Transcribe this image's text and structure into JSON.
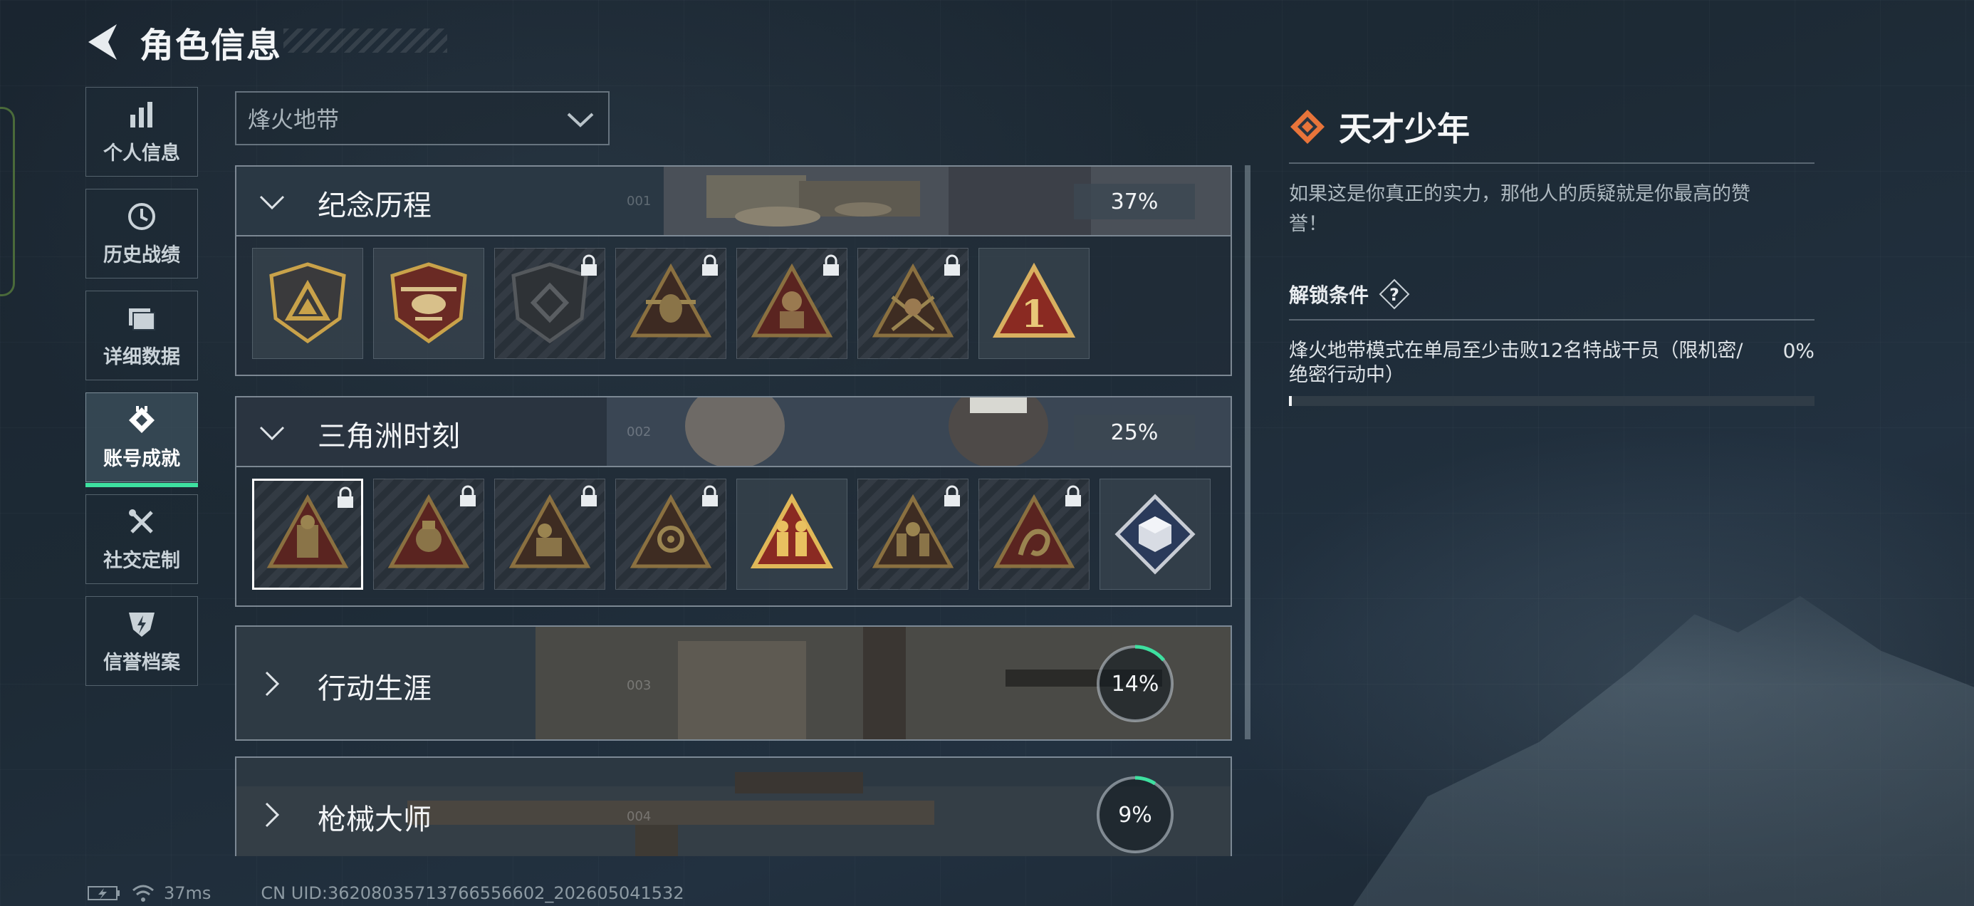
{
  "header": {
    "title": "角色信息"
  },
  "sidebar": {
    "items": [
      {
        "label": "个人信息",
        "icon": "bar-chart-icon"
      },
      {
        "label": "历史战绩",
        "icon": "history-clock-icon"
      },
      {
        "label": "详细数据",
        "icon": "folder-icon"
      },
      {
        "label": "账号成就",
        "icon": "achievement-badge-icon",
        "active": true
      },
      {
        "label": "社交定制",
        "icon": "tools-icon"
      },
      {
        "label": "信誉档案",
        "icon": "lightning-shield-icon"
      }
    ]
  },
  "filter": {
    "selected": "烽火地带"
  },
  "categories": [
    {
      "name": "纪念历程",
      "number": "001",
      "progress": "37%",
      "expanded": true,
      "badges": [
        {
          "icon": "shield-triangle-badge-icon",
          "locked": false
        },
        {
          "icon": "helicopter-badge-icon",
          "locked": false
        },
        {
          "icon": "emblem-badge-icon",
          "locked": true
        },
        {
          "icon": "plane-badge-icon",
          "locked": true
        },
        {
          "icon": "soldier-badge-icon",
          "locked": true
        },
        {
          "icon": "crossed-swords-badge-icon",
          "locked": true
        },
        {
          "icon": "number-one-badge-icon",
          "locked": false,
          "text": "1"
        }
      ]
    },
    {
      "name": "三角洲时刻",
      "number": "002",
      "progress": "25%",
      "expanded": true,
      "badges": [
        {
          "icon": "operator-badge-icon",
          "locked": true,
          "selected": true
        },
        {
          "icon": "medal-badge-icon",
          "locked": true
        },
        {
          "icon": "squad-badge-icon",
          "locked": true
        },
        {
          "icon": "tactical-badge-icon",
          "locked": true
        },
        {
          "icon": "gold-team-badge-icon",
          "locked": false
        },
        {
          "icon": "team-badge-icon",
          "locked": true
        },
        {
          "icon": "dragon-badge-icon",
          "locked": true
        },
        {
          "icon": "cube-badge-icon",
          "locked": false
        }
      ]
    },
    {
      "name": "行动生涯",
      "number": "003",
      "progress": "14%",
      "progress_value": 14,
      "expanded": false
    },
    {
      "name": "枪械大师",
      "number": "004",
      "progress": "9%",
      "progress_value": 9,
      "expanded": false
    }
  ],
  "detail": {
    "title": "天才少年",
    "description": "如果这是你真正的实力，那他人的质疑就是你最高的赞誉！",
    "condition_header": "解锁条件",
    "condition_text": "烽火地带模式在单局至少击败12名特战干员（限机密/绝密行动中）",
    "condition_progress": "0%",
    "condition_progress_value": 0
  },
  "footer": {
    "ping": "37ms",
    "uid": "CN UID:36208035713766556602_202605041532"
  },
  "colors": {
    "accent_green": "#3ee0a0",
    "badge_gold": "#c9a24a",
    "badge_red": "#8a2a22",
    "diamond_orange": "#e8743a"
  }
}
